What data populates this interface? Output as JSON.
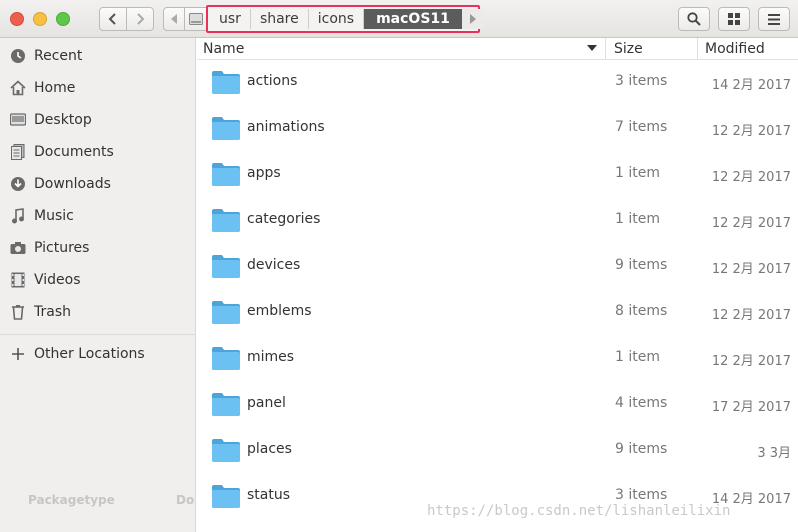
{
  "header": {
    "breadcrumbs": [
      "usr",
      "share",
      "icons",
      "macOS11"
    ]
  },
  "sidebar": {
    "items": [
      {
        "label": "Recent",
        "icon": "clock-icon"
      },
      {
        "label": "Home",
        "icon": "home-icon"
      },
      {
        "label": "Desktop",
        "icon": "desktop-icon"
      },
      {
        "label": "Documents",
        "icon": "documents-icon"
      },
      {
        "label": "Downloads",
        "icon": "download-icon"
      },
      {
        "label": "Music",
        "icon": "music-icon"
      },
      {
        "label": "Pictures",
        "icon": "camera-icon"
      },
      {
        "label": "Videos",
        "icon": "film-icon"
      },
      {
        "label": "Trash",
        "icon": "trash-icon"
      }
    ],
    "other_locations": "Other Locations",
    "ghost_text": [
      "Packagetype",
      "Do"
    ]
  },
  "columns": {
    "name": "Name",
    "size": "Size",
    "modified": "Modified"
  },
  "files": [
    {
      "name": "actions",
      "size": "3 items",
      "modified": "14 2月 2017"
    },
    {
      "name": "animations",
      "size": "7 items",
      "modified": "12 2月 2017"
    },
    {
      "name": "apps",
      "size": "1 item",
      "modified": "12 2月 2017"
    },
    {
      "name": "categories",
      "size": "1 item",
      "modified": "12 2月 2017"
    },
    {
      "name": "devices",
      "size": "9 items",
      "modified": "12 2月 2017"
    },
    {
      "name": "emblems",
      "size": "8 items",
      "modified": "12 2月 2017"
    },
    {
      "name": "mimes",
      "size": "1 item",
      "modified": "12 2月 2017"
    },
    {
      "name": "panel",
      "size": "4 items",
      "modified": "17 2月 2017"
    },
    {
      "name": "places",
      "size": "9 items",
      "modified": "3 3月"
    },
    {
      "name": "status",
      "size": "3 items",
      "modified": "14 2月 2017"
    }
  ],
  "watermark": "https://blog.csdn.net/lishanleilixin",
  "colors": {
    "highlight_border": "#e8325a",
    "active_crumb": "#5c5c5c",
    "folder_blue": "#5fb8f0"
  }
}
